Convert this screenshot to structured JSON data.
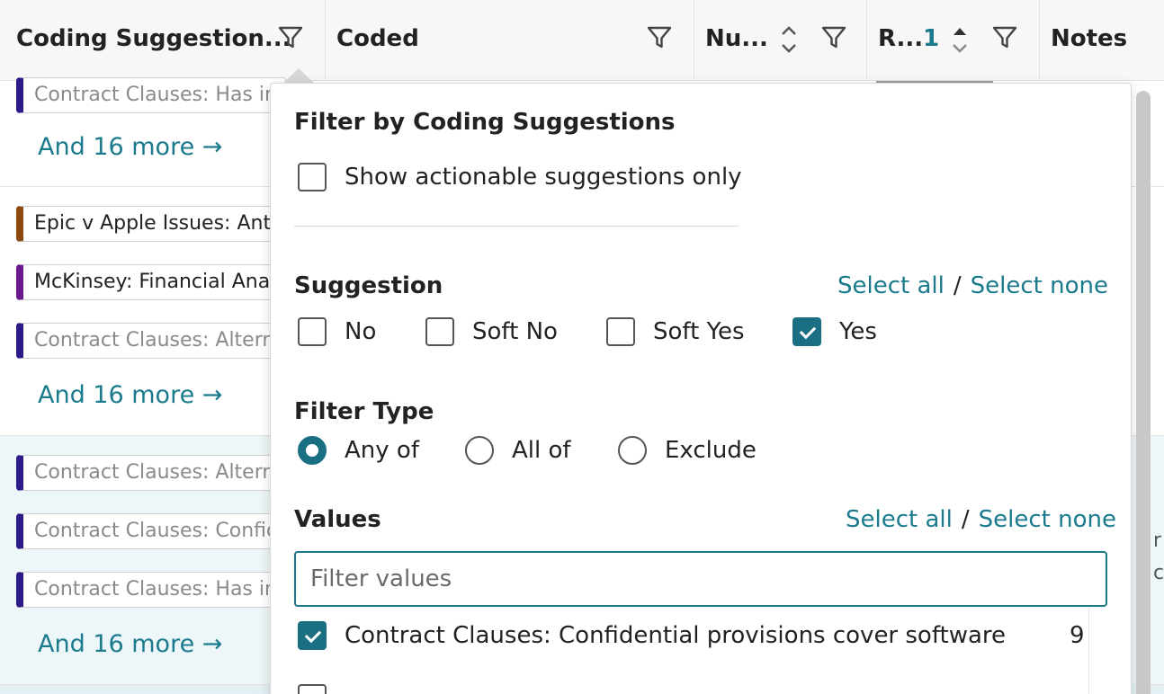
{
  "header": {
    "columns": [
      {
        "title": "Coding Suggestion..."
      },
      {
        "title": "Coded"
      },
      {
        "title": "Nu..."
      },
      {
        "title": "R...",
        "sort_order": "1"
      },
      {
        "title": "Notes"
      }
    ]
  },
  "rows": [
    {
      "tags": [
        {
          "text": "Contract Clauses: Has in",
          "color": "#2d1b8a",
          "style": "muted"
        }
      ],
      "more": "And 16 more →"
    },
    {
      "tags": [
        {
          "text": "Epic v Apple Issues: Ant",
          "color": "#8a4a10",
          "style": "solid"
        },
        {
          "text": "McKinsey: Financial Ana",
          "color": "#6a1a8a",
          "style": "solid"
        },
        {
          "text": "Contract Clauses: Altern",
          "color": "#2d1b8a",
          "style": "muted"
        }
      ],
      "more": "And 16 more →"
    },
    {
      "tags": [
        {
          "text": "Contract Clauses: Altern",
          "color": "#2d1b8a",
          "style": "muted"
        },
        {
          "text": "Contract Clauses: Confid",
          "color": "#2d1b8a",
          "style": "muted"
        },
        {
          "text": "Contract Clauses: Has in",
          "color": "#2d1b8a",
          "style": "muted"
        }
      ],
      "more": "And 16 more →"
    }
  ],
  "right_fragments": [
    "r",
    "c"
  ],
  "popover": {
    "title": "Filter by Coding Suggestions",
    "actionable_label": "Show actionable suggestions only",
    "actionable_checked": false,
    "suggestion": {
      "heading": "Suggestion",
      "select_all": "Select all",
      "separator": "/",
      "select_none": "Select none",
      "options": [
        {
          "label": "No",
          "checked": false
        },
        {
          "label": "Soft No",
          "checked": false
        },
        {
          "label": "Soft Yes",
          "checked": false
        },
        {
          "label": "Yes",
          "checked": true
        }
      ]
    },
    "filter_type": {
      "heading": "Filter Type",
      "options": [
        {
          "label": "Any of",
          "selected": true
        },
        {
          "label": "All of",
          "selected": false
        },
        {
          "label": "Exclude",
          "selected": false
        }
      ]
    },
    "values": {
      "heading": "Values",
      "select_all": "Select all",
      "separator": "/",
      "select_none": "Select none",
      "placeholder": "Filter values",
      "items": [
        {
          "label": "Contract Clauses: Confidential provisions cover software",
          "count": "9",
          "checked": true
        }
      ]
    }
  },
  "colors": {
    "accent": "#1b7a8c",
    "checked": "#1b6f82",
    "header_bg": "#f7f7f7",
    "selected_row_bg": "#edf6f8"
  }
}
